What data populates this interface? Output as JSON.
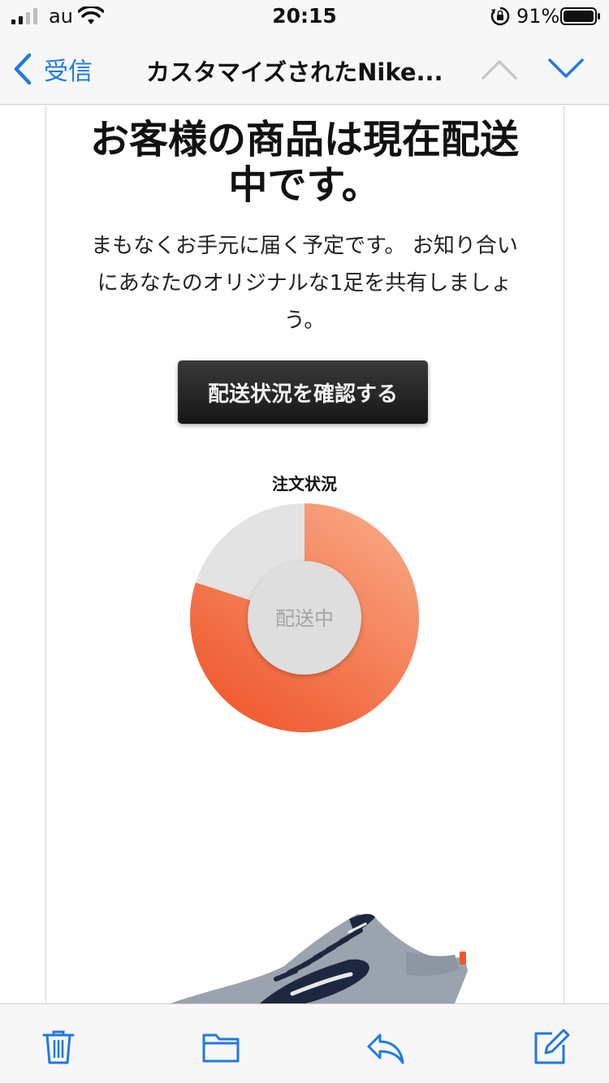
{
  "status_bar": {
    "carrier": "au",
    "time": "20:15",
    "battery_percent": "91%"
  },
  "nav": {
    "back_label": "受信",
    "title": "カスタマイズされたNike..."
  },
  "email": {
    "headline_line1": "お客様の商品は現在配送",
    "headline_line2": "中です。",
    "body_line1": "まもなくお手元に届く予定です。 お知り合い",
    "body_line2": "にあなたのオリジナルな1足を共有しましょ",
    "body_line3": "う。",
    "cta_label": "配送状況を確認する",
    "chart_title": "注文状況",
    "chart_center_label": "配送中"
  },
  "chart_data": {
    "type": "pie",
    "title": "注文状況",
    "center_label": "配送中",
    "values": [
      0.8,
      0.2
    ],
    "colors": [
      "#f26430",
      "#e3e3e3"
    ]
  },
  "icons": {
    "status": [
      "signal-icon",
      "wifi-icon",
      "rotation-lock-icon",
      "battery-icon"
    ],
    "nav": [
      "chevron-left-icon",
      "chevron-up-icon",
      "chevron-down-icon"
    ],
    "toolbar": [
      "trash-icon",
      "folder-icon",
      "reply-icon",
      "compose-icon"
    ]
  },
  "colors": {
    "accent": "#1f7ae0",
    "progress_start": "#f8a884",
    "progress_end": "#f0552a",
    "remaining": "#e3e3e3"
  }
}
